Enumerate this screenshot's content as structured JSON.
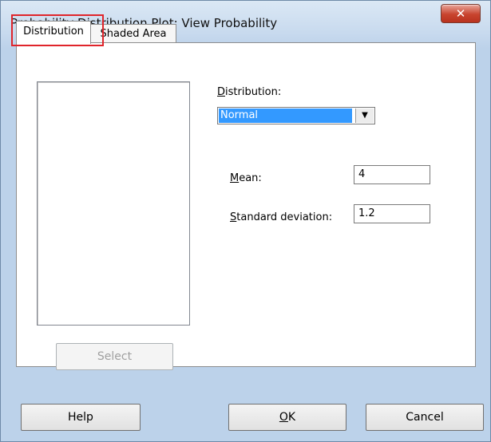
{
  "window": {
    "title": "Probability Distribution Plot: View Probability",
    "close_glyph": "✕"
  },
  "tabs": [
    {
      "label": "Distribution",
      "selected": true
    },
    {
      "label": "Shaded Area",
      "selected": false
    }
  ],
  "list": {
    "items": []
  },
  "select_button": {
    "label": "Select",
    "enabled": false
  },
  "distribution": {
    "label_first": "D",
    "label_rest": "istribution:",
    "selected": "Normal",
    "arrow_glyph": "▼"
  },
  "mean": {
    "label_first": "M",
    "label_rest": "ean:",
    "value": "4"
  },
  "stddev": {
    "label_first": "S",
    "label_rest": "tandard deviation:",
    "value": "1.2"
  },
  "buttons": {
    "help": "Help",
    "ok_first": "O",
    "ok_rest": "K",
    "cancel": "Cancel"
  },
  "colors": {
    "highlight": "#e0252b",
    "selection": "#3399ff",
    "close": "#c8442f"
  }
}
